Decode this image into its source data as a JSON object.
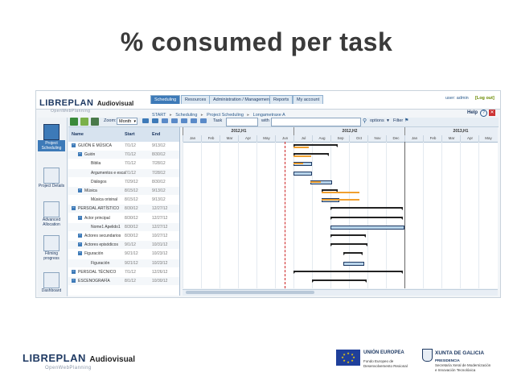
{
  "slide": {
    "title": "% consumed per task"
  },
  "app": {
    "logo": {
      "main": "LIBREPLAN",
      "sub": "OpenWebPlanning",
      "product": "Audiovisual"
    },
    "tabs": [
      {
        "label": "Scheduling",
        "active": true
      },
      {
        "label": "Resources",
        "active": false
      },
      {
        "label": "Administration / Management",
        "active": false
      },
      {
        "label": "Reports",
        "active": false
      },
      {
        "label": "My account",
        "active": false
      }
    ],
    "user": {
      "label": "user: admin",
      "logout": "[Log out]"
    },
    "help": "Help",
    "breadcrumb": [
      "START",
      "Scheduling",
      "Project Scheduling",
      "Longametraxe A"
    ],
    "toolbar": {
      "zoom_label": "Zoom:",
      "zoom_value": "Month",
      "task_label": "Task",
      "with_label": "with",
      "options_label": "options",
      "filter_label": "Filter"
    },
    "sidebar": [
      {
        "label": "Project Scheduling",
        "icon": "calendar-icon"
      },
      {
        "label": "Project Details",
        "icon": "document-icon"
      },
      {
        "label": "Advanced Allocation",
        "icon": "grid-icon"
      },
      {
        "label": "Filming progress",
        "icon": "chart-icon"
      },
      {
        "label": "Dashboard",
        "icon": "dashboard-icon"
      }
    ],
    "columns": {
      "name": "Name",
      "start": "Start",
      "end": "End"
    },
    "halves": [
      "2012,H1",
      "2012,H2",
      "2013,H1"
    ],
    "months": [
      "Jan",
      "Feb",
      "Mar",
      "Apr",
      "May",
      "Jun",
      "Jul",
      "Aug",
      "Sep",
      "Oct",
      "Nov",
      "Dec",
      "Jan",
      "Feb",
      "Mar",
      "Apr",
      "May"
    ],
    "tasks": [
      {
        "name": "GUIÓN E MÚSICA",
        "start": "7/1/12",
        "end": "9/13/12",
        "level": 0,
        "type": "group",
        "bar_start": 6.0,
        "bar_end": 8.4,
        "progress": 0.35
      },
      {
        "name": "Guión",
        "start": "7/1/12",
        "end": "8/30/12",
        "level": 1,
        "type": "group",
        "bar_start": 6.0,
        "bar_end": 7.9,
        "progress": 0.5
      },
      {
        "name": "Biblia",
        "start": "7/1/12",
        "end": "7/28/12",
        "level": 2,
        "type": "task",
        "bar_start": 6.0,
        "bar_end": 6.9,
        "progress": 0.6
      },
      {
        "name": "Argumentos e esca",
        "start": "7/1/12",
        "end": "7/28/12",
        "level": 2,
        "type": "task",
        "bar_start": 6.0,
        "bar_end": 6.9,
        "progress": 0.0
      },
      {
        "name": "Diálogos",
        "start": "7/29/12",
        "end": "8/30/12",
        "level": 2,
        "type": "task",
        "bar_start": 6.9,
        "bar_end": 7.99,
        "progress": 0.55
      },
      {
        "name": "Música",
        "start": "8/15/12",
        "end": "9/13/12",
        "level": 1,
        "type": "group",
        "bar_start": 7.5,
        "bar_end": 8.4,
        "progress": 2.3
      },
      {
        "name": "Música orixinal",
        "start": "8/15/12",
        "end": "9/13/12",
        "level": 2,
        "type": "task",
        "bar_start": 7.5,
        "bar_end": 8.4,
        "progress": 2.3
      },
      {
        "name": "PERSOAL ARTÍSTICO",
        "start": "8/30/12",
        "end": "12/27/12",
        "level": 0,
        "type": "group",
        "bar_start": 8.0,
        "bar_end": 11.9,
        "progress": 0.0
      },
      {
        "name": "Actor principal",
        "start": "8/30/12",
        "end": "12/27/12",
        "level": 1,
        "type": "group",
        "bar_start": 8.0,
        "bar_end": 11.9,
        "progress": 0.0
      },
      {
        "name": "Nome1 Apelido1",
        "start": "8/30/12",
        "end": "12/27/12",
        "level": 2,
        "type": "task",
        "bar_start": 8.0,
        "bar_end": 11.9,
        "progress": 0.0
      },
      {
        "name": "Actores secundarios",
        "start": "8/30/12",
        "end": "10/27/12",
        "level": 1,
        "type": "group",
        "bar_start": 8.0,
        "bar_end": 9.9,
        "progress": 0.0
      },
      {
        "name": "Actores episódicos",
        "start": "9/1/12",
        "end": "10/31/12",
        "level": 1,
        "type": "group",
        "bar_start": 8.0,
        "bar_end": 10.0,
        "progress": 0.0
      },
      {
        "name": "Figuración",
        "start": "9/21/12",
        "end": "10/23/12",
        "level": 1,
        "type": "group",
        "bar_start": 8.7,
        "bar_end": 9.75,
        "progress": 0.0
      },
      {
        "name": "Figuración",
        "start": "9/21/12",
        "end": "10/23/12",
        "level": 2,
        "type": "task",
        "bar_start": 8.7,
        "bar_end": 9.75,
        "progress": 0.0
      },
      {
        "name": "PERSOAL TÉCNICO",
        "start": "7/1/12",
        "end": "12/26/12",
        "level": 0,
        "type": "group",
        "bar_start": 6.0,
        "bar_end": 11.9,
        "progress": 0.0
      },
      {
        "name": "ESCENOGRAFÍA",
        "start": "8/1/12",
        "end": "10/30/12",
        "level": 0,
        "type": "group",
        "bar_start": 7.0,
        "bar_end": 9.95,
        "progress": 0.0
      }
    ],
    "today_month": 5.5
  },
  "footer": {
    "logo": {
      "main": "LIBREPLAN",
      "sub": "OpenWebPlanning",
      "product": "Audiovisual"
    },
    "eu": {
      "title": "UNIÓN EUROPEA",
      "line1": "Fondo Europeo de",
      "line2": "Desenvolvemento Rexional"
    },
    "xunta": {
      "title": "XUNTA DE GALICIA",
      "line1": "PRESIDENCIA",
      "line2": "Secretaría Xeral de Modernización",
      "line3": "e Innovación Tecnolóxica"
    }
  },
  "colors": {
    "accent": "#3d7ab8",
    "task_bar": "#b8d4ea",
    "progress": "#f0a030",
    "group_bar": "#222222",
    "today_line": "#cc2222"
  }
}
